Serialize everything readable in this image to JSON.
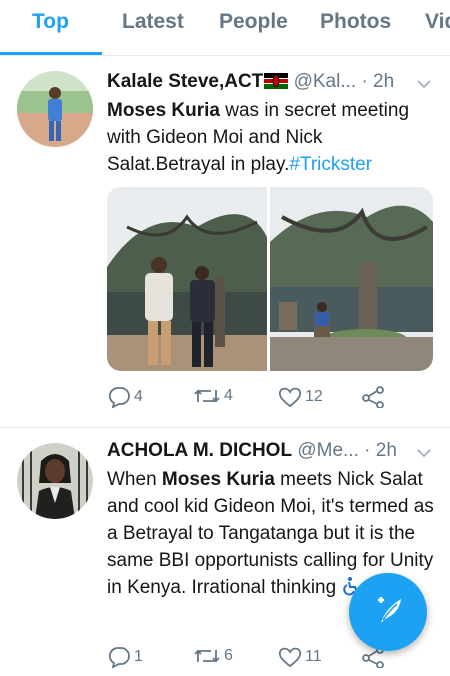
{
  "tabs": [
    {
      "label": "Top",
      "active": true
    },
    {
      "label": "Latest",
      "active": false
    },
    {
      "label": "People",
      "active": false
    },
    {
      "label": "Photos",
      "active": false
    },
    {
      "label": "Vid",
      "active": false
    }
  ],
  "tweets": [
    {
      "name": "Kalale Steve,ACT",
      "flag": "kenya-flag-icon",
      "handle": "@Kal...",
      "time": "· 2h",
      "text": {
        "mention": "Moses Kuria",
        "part1": " was in secret meeting with Gideon Moi and Nick Salat.Betrayal in play.",
        "hashtag": "#Trickster"
      },
      "media": [
        "two men in suits under a large tree",
        "garden courtyard with a large tree"
      ],
      "counts": {
        "replies": "4",
        "retweets": "4",
        "likes": "12"
      }
    },
    {
      "name": "ACHOLA M. DICHOL",
      "handle": "@Me...",
      "time": "· 2h",
      "text": {
        "part1": "When ",
        "bold": "Moses Kuria",
        "part2": " meets Nick Salat and cool kid Gideon Moi, it's termed as a Betrayal to Tangatanga but it is the same BBI opportunists calling for Unity in Kenya. Irra",
        "hidden_part": "tional",
        "part3": " thinking",
        "emoji": "wheelchair-icon"
      },
      "counts": {
        "replies": "1",
        "retweets": "6",
        "likes": "11"
      }
    }
  ],
  "fab": {
    "icon": "compose-tweet-icon"
  },
  "colors": {
    "accent": "#1da1f2",
    "muted": "#657786",
    "text": "#14171a",
    "divider": "#e6ecf0"
  }
}
